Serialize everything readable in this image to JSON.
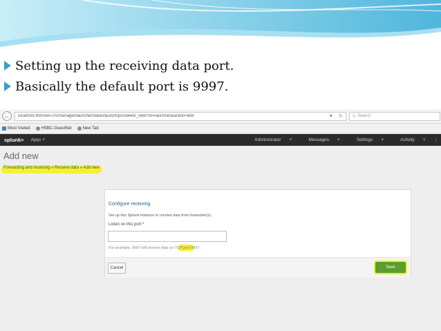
{
  "slide": {
    "bullets": [
      "Setting up the receiving data port.",
      "Basically the default port is 9997."
    ]
  },
  "browser": {
    "url": "localhost:8000/en-US/manager/launcher/data/inputs/tcp/cooked/_new?ns=launcher&action=edit",
    "search_placeholder": "Search",
    "bookmarks": [
      "Most Visited",
      "HSBC-GuestNet",
      "New Tab"
    ]
  },
  "splunk": {
    "logo": "splunk>",
    "apps_menu": "Apps",
    "right_menus": [
      "Administrator",
      "Messages",
      "Settings",
      "Activity"
    ],
    "page_heading": "Add new",
    "breadcrumb": "Forwarding and receiving » Receive data » Add new",
    "panel": {
      "title": "Configure receiving",
      "description": "Set up this Splunk instance to receive data from forwarder(s).",
      "field_label": "Listen on this port *",
      "port_value": "",
      "help_text": "For example, 9997 will receive data on TCP port 9997."
    },
    "buttons": {
      "cancel": "Cancel",
      "save": "Save"
    }
  },
  "colors": {
    "bullet_arrow": "#3aa0c8",
    "highlight": "#f5f020",
    "save_green": "#5a9e2e",
    "splunk_bar": "#2b2b2b"
  }
}
